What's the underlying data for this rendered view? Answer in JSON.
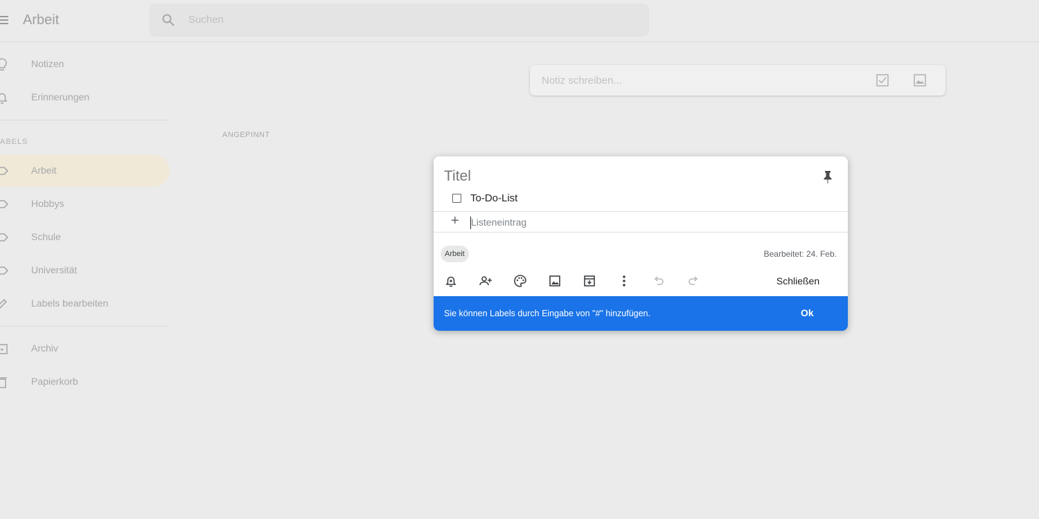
{
  "header": {
    "app_title": "Arbeit",
    "search_placeholder": "Suchen"
  },
  "sidebar": {
    "items": [
      {
        "label": "Notizen",
        "icon": "lightbulb-icon"
      },
      {
        "label": "Erinnerungen",
        "icon": "bell-icon"
      }
    ],
    "labels_heading": "ABELS",
    "label_items": [
      {
        "label": "Arbeit",
        "icon": "label-icon",
        "active": true
      },
      {
        "label": "Hobbys",
        "icon": "label-icon"
      },
      {
        "label": "Schule",
        "icon": "label-icon"
      },
      {
        "label": "Universität",
        "icon": "label-icon"
      },
      {
        "label": "Labels bearbeiten",
        "icon": "pencil-icon"
      }
    ],
    "bottom_items": [
      {
        "label": "Archiv",
        "icon": "archive-icon"
      },
      {
        "label": "Papierkorb",
        "icon": "trash-icon"
      }
    ]
  },
  "take_note": {
    "placeholder": "Notiz schreiben..."
  },
  "main": {
    "pinned_heading": "ANGEPINNT"
  },
  "note_editor": {
    "title_placeholder": "Titel",
    "items": [
      {
        "text": "To-Do-List",
        "checked": false
      }
    ],
    "add_item_placeholder": "Listeneintrag",
    "label_chip": "Arbeit",
    "edited": "Bearbeitet: 24. Feb.",
    "close_label": "Schließen",
    "toast": {
      "message": "Sie können Labels durch Eingabe von \"#\" hinzufügen.",
      "action": "Ok"
    }
  },
  "colors": {
    "toast_bg": "#1a73e8",
    "active_label_bg": "#f0e9d8",
    "page_bg": "#ebebeb"
  }
}
